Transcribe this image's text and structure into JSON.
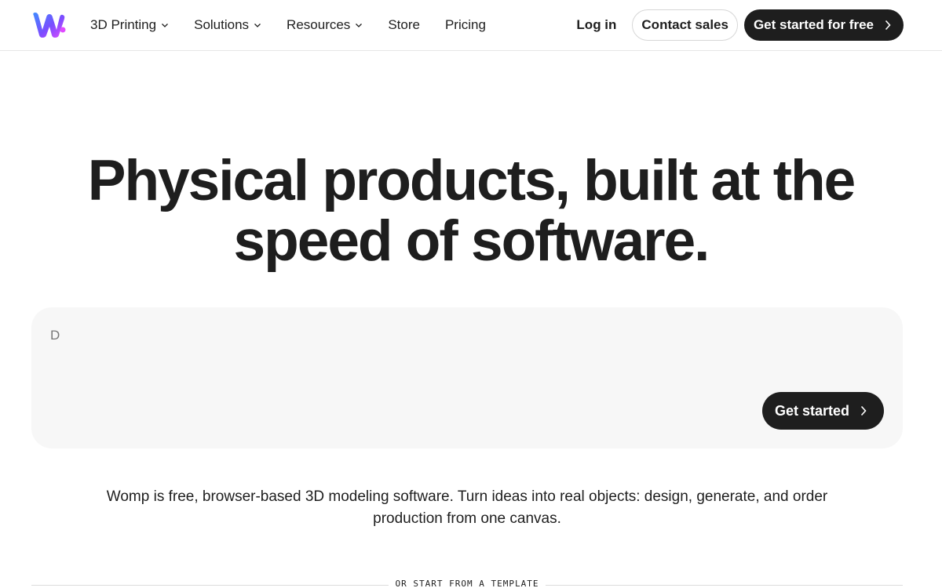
{
  "nav": {
    "logo_icon": "womp-logo-icon",
    "menu": [
      {
        "label": "3D Printing",
        "dropdown": true
      },
      {
        "label": "Solutions",
        "dropdown": true
      },
      {
        "label": "Resources",
        "dropdown": true
      },
      {
        "label": "Store",
        "dropdown": false
      },
      {
        "label": "Pricing",
        "dropdown": false
      }
    ],
    "login_label": "Log in",
    "contact_label": "Contact sales",
    "cta_label": "Get started for free"
  },
  "hero": {
    "title_line1": "Physical products, built at the",
    "title_line2": "speed of software."
  },
  "prompt": {
    "typed_text": "D",
    "button_label": "Get started"
  },
  "description": {
    "line1": "Womp is free, browser-based 3D modeling software. Turn ideas into real objects: design, generate, and order",
    "line2": "production from one canvas."
  },
  "templates": {
    "divider_label": "OR START FROM A TEMPLATE"
  },
  "colors": {
    "text": "#1e1e1e",
    "button_dark": "#1e1e1e",
    "prompt_bg": "#f7f7f7",
    "logo_gradient": [
      "#3f8cff",
      "#7a4dff",
      "#e04bff"
    ]
  }
}
